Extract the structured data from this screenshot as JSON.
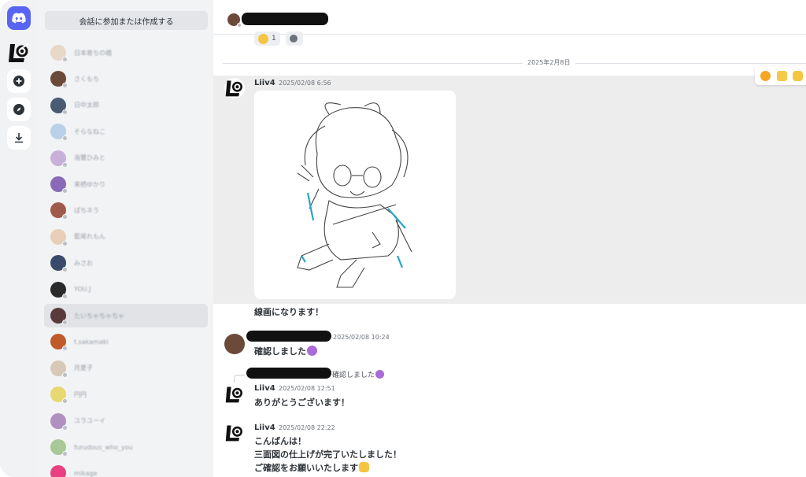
{
  "server_rail": {
    "icons": [
      "discord-icon",
      "liiv4-server-icon",
      "add-server-icon",
      "explore-icon",
      "download-icon"
    ]
  },
  "dm_panel": {
    "search_label": "会話に参加または作成する",
    "items": [
      {
        "name": "日本寄ちの橋",
        "avatar": "#e8d8c8"
      },
      {
        "name": "さくもち",
        "avatar": "#6b4a3a"
      },
      {
        "name": "日中太郎",
        "avatar": "#4a5a72"
      },
      {
        "name": "そらなねこ",
        "avatar": "#b8d0e8"
      },
      {
        "name": "海鷺ひみと",
        "avatar": "#c8b0d8"
      },
      {
        "name": "来栖ゆかり",
        "avatar": "#8a6ab8"
      },
      {
        "name": "ぱちネう",
        "avatar": "#a05a4a"
      },
      {
        "name": "藍尾れもん",
        "avatar": "#e8d0b8"
      },
      {
        "name": "みさお",
        "avatar": "#3a4a6a"
      },
      {
        "name": "YOU.J",
        "avatar": "#2a2a2a"
      },
      {
        "name": "たいちゃちゃちゃ",
        "avatar": "#5a3a3a"
      },
      {
        "name": "t.sakamaki",
        "avatar": "#c05a2a"
      },
      {
        "name": "月夏子",
        "avatar": "#d8c8b8"
      },
      {
        "name": "円円",
        "avatar": "#e8d870"
      },
      {
        "name": "ユラユーイ",
        "avatar": "#b090c0"
      },
      {
        "name": "furudous_who_you",
        "avatar": "#a8c898"
      },
      {
        "name": "mikage",
        "avatar": "#e84080"
      }
    ]
  },
  "chat": {
    "reactions": [
      {
        "emoji": "person-emoji",
        "count": "1"
      },
      {
        "emoji": "add-reaction-icon",
        "count": ""
      }
    ],
    "date_divider": "2025年2月8日",
    "hover_actions": [
      "emoji-reaction-icon",
      "thumbs-up-icon",
      "hands-icon"
    ],
    "messages": [
      {
        "author": "Liiv4",
        "time": "2025/02/08 6:56",
        "text": "線画になります！"
      },
      {
        "author": "",
        "time": "2025/02/08 10:24",
        "text": "確認しました"
      },
      {
        "author": "Liiv4",
        "time": "2025/02/08 12:51",
        "reply_text": "確認しました",
        "text": "ありがとうございます！"
      },
      {
        "author": "Liiv4",
        "time": "2025/02/08 22:22",
        "lines": [
          "こんばんは！",
          "三面図の仕上げが完了いたしました！",
          "ご確認をお願いいたします"
        ]
      }
    ]
  }
}
